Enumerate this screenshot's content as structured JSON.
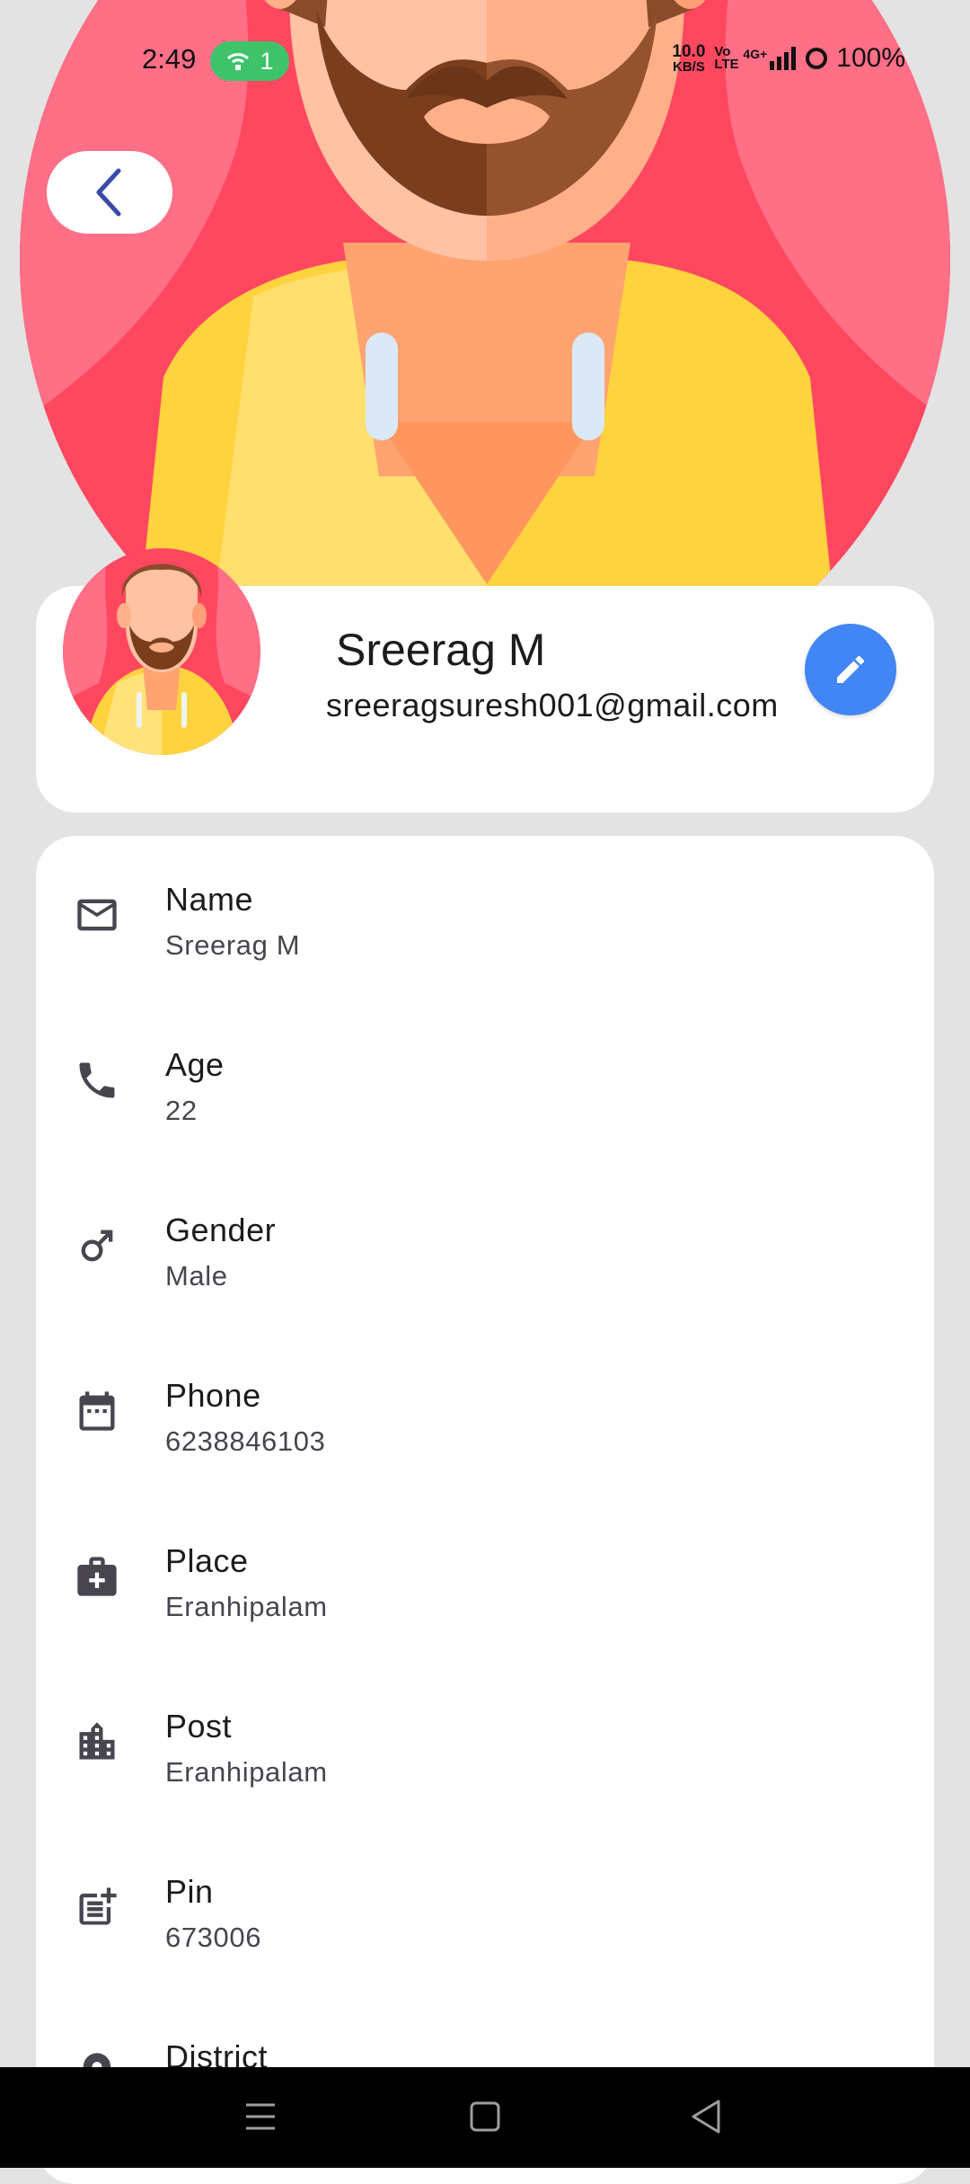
{
  "status_bar": {
    "time": "2:49",
    "hotspot_count": "1",
    "net_speed_value": "10.0",
    "net_speed_unit": "KB/S",
    "volte": "Vo LTE",
    "signal": "4G+",
    "battery": "100%"
  },
  "profile": {
    "name": "Sreerag M",
    "email": "sreeragsuresh001@gmail.com"
  },
  "details": [
    {
      "label": "Name",
      "value": "Sreerag M",
      "icon": "mail-icon"
    },
    {
      "label": "Age",
      "value": "22",
      "icon": "phone-icon"
    },
    {
      "label": "Gender",
      "value": "Male",
      "icon": "male-icon"
    },
    {
      "label": "Phone",
      "value": "6238846103",
      "icon": "calendar-icon"
    },
    {
      "label": "Place",
      "value": "Eranhipalam",
      "icon": "medical-bag-icon"
    },
    {
      "label": "Post",
      "value": "Eranhipalam",
      "icon": "city-icon"
    },
    {
      "label": "Pin",
      "value": "673006",
      "icon": "post-add-icon"
    },
    {
      "label": "District",
      "value": "",
      "icon": "location-icon"
    }
  ],
  "colors": {
    "accent": "#4285f4",
    "back_chevron": "#3a4aa8",
    "background": "#e3e3e3",
    "card": "#ffffff"
  }
}
